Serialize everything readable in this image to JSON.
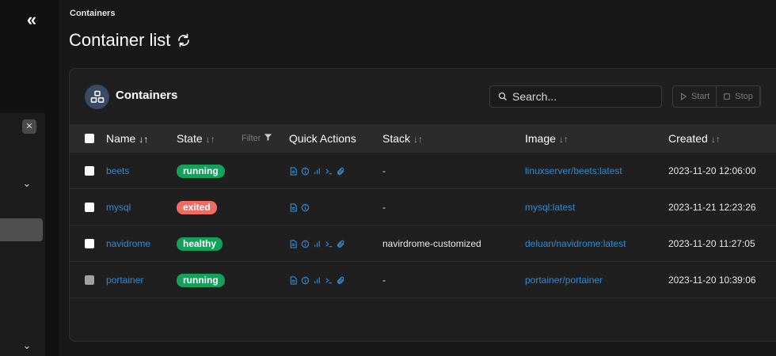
{
  "breadcrumb": "Containers",
  "page_title": "Container list",
  "card": {
    "title": "Containers",
    "search_placeholder": "Search...",
    "actions": [
      {
        "label": "Start",
        "icon": "play-icon"
      },
      {
        "label": "Stop",
        "icon": "stop-icon"
      }
    ]
  },
  "table": {
    "headers": {
      "name": "Name",
      "state": "State",
      "filter": "Filter",
      "quick_actions": "Quick Actions",
      "stack": "Stack",
      "image": "Image",
      "created": "Created"
    },
    "rows": [
      {
        "name": "beets",
        "state": "running",
        "quick_actions": [
          "logs-icon",
          "inspect-icon",
          "stats-icon",
          "console-icon",
          "attach-icon"
        ],
        "stack": "-",
        "image": "linuxserver/beets:latest",
        "created": "2023-11-20 12:06:00"
      },
      {
        "name": "mysql",
        "state": "exited",
        "quick_actions": [
          "logs-icon",
          "inspect-icon"
        ],
        "stack": "-",
        "image": "mysql:latest",
        "created": "2023-11-21 12:23:26"
      },
      {
        "name": "navidrome",
        "state": "healthy",
        "quick_actions": [
          "logs-icon",
          "inspect-icon",
          "stats-icon",
          "console-icon",
          "attach-icon"
        ],
        "stack": "navirdrome-customized",
        "image": "deluan/navidrome:latest",
        "created": "2023-11-20 11:27:05"
      },
      {
        "name": "portainer",
        "state": "running",
        "quick_actions": [
          "logs-icon",
          "inspect-icon",
          "stats-icon",
          "console-icon",
          "attach-icon"
        ],
        "stack": "-",
        "image": "portainer/portainer",
        "created": "2023-11-20 10:39:06"
      }
    ]
  },
  "colors": {
    "link": "#2f8bd6",
    "running": "#12a25a",
    "exited": "#f26b63"
  }
}
